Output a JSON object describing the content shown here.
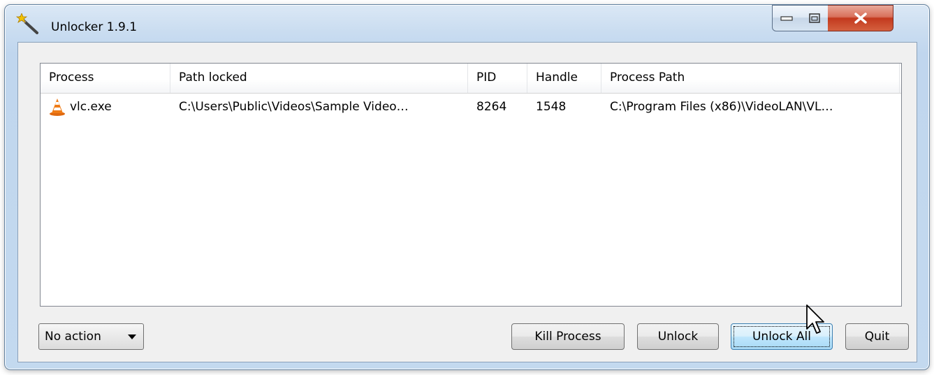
{
  "window": {
    "title": "Unlocker 1.9.1",
    "app_icon": "magic-wand-icon",
    "controls": [
      "minimize-icon",
      "maximize-icon",
      "close-icon"
    ]
  },
  "list": {
    "columns": [
      "Process",
      "Path locked",
      "PID",
      "Handle",
      "Process Path"
    ],
    "rows": [
      {
        "icon": "vlc-cone-icon",
        "process": "vlc.exe",
        "path_locked": "C:\\Users\\Public\\Videos\\Sample Video…",
        "pid": "8264",
        "handle": "1548",
        "process_path": "C:\\Program Files (x86)\\VideoLAN\\VL…"
      }
    ]
  },
  "action_select": {
    "selected": "No action"
  },
  "buttons": {
    "kill_process": "Kill Process",
    "unlock": "Unlock",
    "unlock_all": "Unlock All",
    "quit": "Quit"
  },
  "colors": {
    "frame": "#c3d9ef",
    "close_button": "#c3391d",
    "focus_button": "#bee6fd"
  }
}
